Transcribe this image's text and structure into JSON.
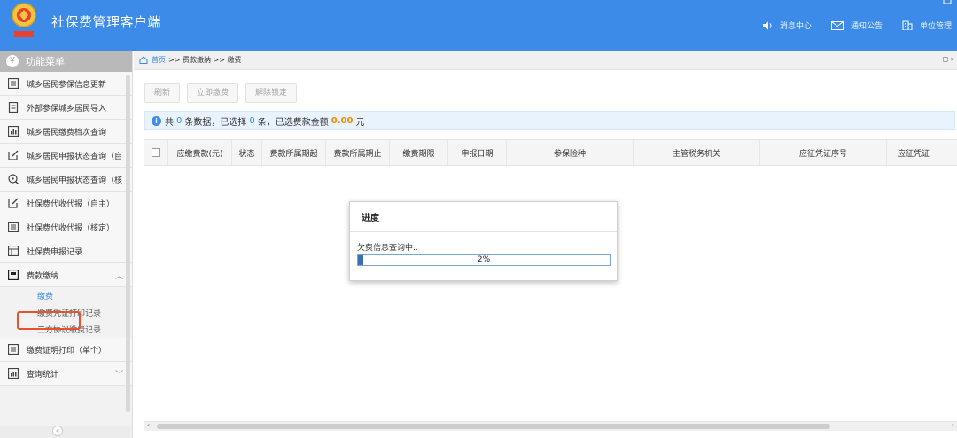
{
  "header": {
    "title": "社保费管理客户端",
    "nav": [
      {
        "label": "消息中心",
        "icon": "speaker-icon"
      },
      {
        "label": "通知公告",
        "icon": "mail-icon"
      },
      {
        "label": "单位管理",
        "icon": "building-icon"
      }
    ]
  },
  "sidebar": {
    "header": "功能菜单",
    "items": [
      {
        "label": "城乡居民参保信息更新",
        "icon": "list-icon"
      },
      {
        "label": "外部参保城乡居民导入",
        "icon": "document-icon"
      },
      {
        "label": "城乡居民缴费档次查询",
        "icon": "chart-icon"
      },
      {
        "label": "城乡居民申报状态查询（自",
        "icon": "edit-icon"
      },
      {
        "label": "城乡居民申报状态查询（核",
        "icon": "search-icon"
      },
      {
        "label": "社保费代收代报（自主）",
        "icon": "edit-icon"
      },
      {
        "label": "社保费代收代报（核定）",
        "icon": "list-icon"
      },
      {
        "label": "社保费申报记录",
        "icon": "table-icon"
      },
      {
        "label": "费款缴纳",
        "icon": "folder-icon"
      }
    ],
    "sub_items": [
      {
        "label": "缴费",
        "active": true
      },
      {
        "label": "缴费凭证打印记录",
        "active": false
      },
      {
        "label": "三方协议缴费记录",
        "active": false
      }
    ],
    "items_after": [
      {
        "label": "缴费证明打印（单个）",
        "icon": "list-icon"
      },
      {
        "label": "查询统计",
        "icon": "chart-icon"
      }
    ]
  },
  "breadcrumb": {
    "home": "首页",
    "path": ">> 费款缴纳 >> 缴费"
  },
  "toolbar": {
    "refresh": "刷新",
    "pay_now": "立即缴费",
    "unlock": "解除锁定"
  },
  "info": {
    "prefix": "共",
    "count": "0",
    "mid": "条数据，已选择",
    "selected": "0",
    "mid2": "条，已选费款金额",
    "amount": "0.00",
    "suffix": "元"
  },
  "table": {
    "columns": [
      "应缴费款(元)",
      "状态",
      "费款所属期起",
      "费款所属期止",
      "缴费期限",
      "申报日期",
      "参保险种",
      "主管税务机关",
      "应征凭证序号",
      "应征凭证"
    ]
  },
  "dialog": {
    "title": "进度",
    "message": "欠费信息查询中..",
    "progress_text": "2%",
    "progress": 0.02
  },
  "colors": {
    "header_bg": "#3d8be8",
    "highlight_border": "#e8532e",
    "amount": "#f08c00",
    "progress_fill": "#3a6fb2"
  }
}
